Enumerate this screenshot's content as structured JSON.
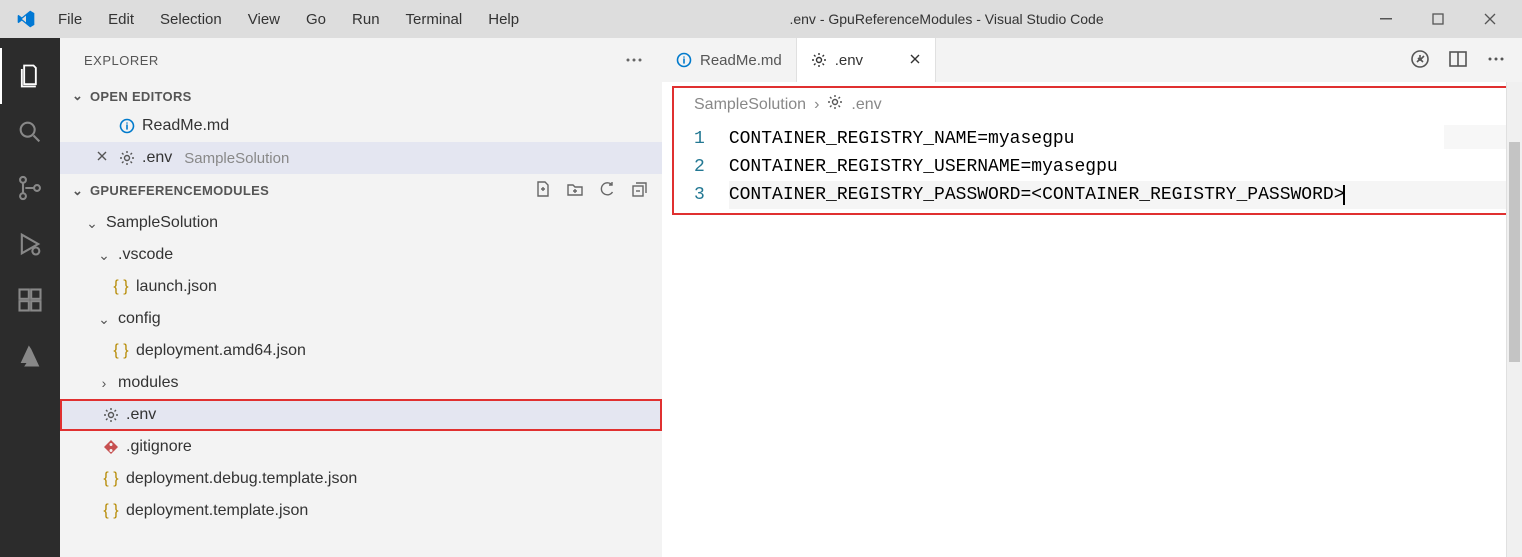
{
  "titlebar": {
    "title": ".env - GpuReferenceModules - Visual Studio Code"
  },
  "menu": {
    "file": "File",
    "edit": "Edit",
    "selection": "Selection",
    "view": "View",
    "go": "Go",
    "run": "Run",
    "terminal": "Terminal",
    "help": "Help"
  },
  "sidebar": {
    "title": "EXPLORER",
    "open_editors_label": "OPEN EDITORS",
    "folder_name": "GPUREFERENCEMODULES",
    "open_editors": [
      {
        "name": "ReadMe.md",
        "icon": "info",
        "close": false
      },
      {
        "name": ".env",
        "detail": "SampleSolution",
        "icon": "gear",
        "close": true,
        "selected": true
      }
    ],
    "tree": {
      "root": "SampleSolution",
      "items": [
        {
          "name": ".vscode",
          "kind": "folder",
          "open": true,
          "level": 1
        },
        {
          "name": "launch.json",
          "kind": "json",
          "level": 2
        },
        {
          "name": "config",
          "kind": "folder",
          "open": true,
          "level": 1
        },
        {
          "name": "deployment.amd64.json",
          "kind": "json",
          "level": 2
        },
        {
          "name": "modules",
          "kind": "folder",
          "open": false,
          "level": 1
        },
        {
          "name": ".env",
          "kind": "gear",
          "level": 1,
          "highlight": true
        },
        {
          "name": ".gitignore",
          "kind": "git",
          "level": 1
        },
        {
          "name": "deployment.debug.template.json",
          "kind": "json",
          "level": 1
        },
        {
          "name": "deployment.template.json",
          "kind": "json",
          "level": 1
        }
      ]
    }
  },
  "tabs": {
    "readme": "ReadMe.md",
    "env": ".env"
  },
  "breadcrumb": {
    "parent": "SampleSolution",
    "sep": "›",
    "file": ".env"
  },
  "editor": {
    "line_numbers": [
      "1",
      "2",
      "3"
    ],
    "lines": [
      "CONTAINER_REGISTRY_NAME=myasegpu",
      "CONTAINER_REGISTRY_USERNAME=myasegpu",
      "CONTAINER_REGISTRY_PASSWORD=<CONTAINER_REGISTRY_PASSWORD>"
    ]
  }
}
